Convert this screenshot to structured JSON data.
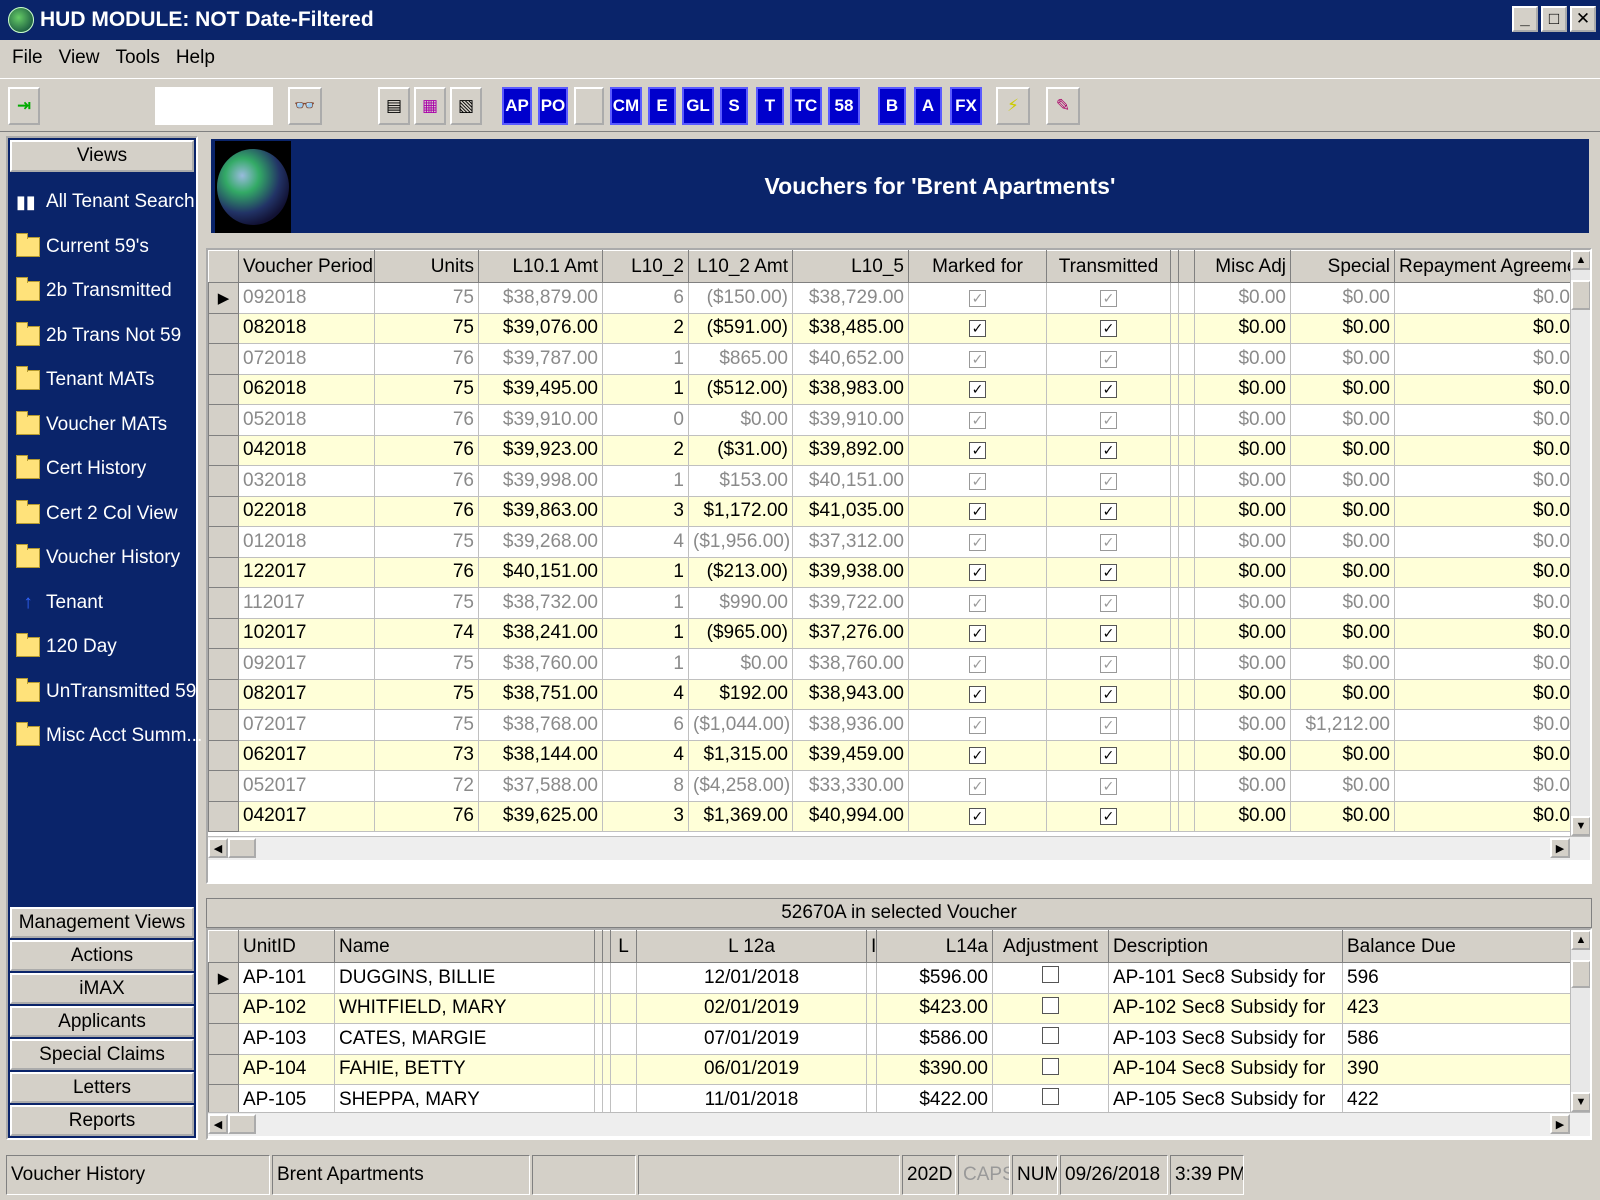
{
  "window": {
    "title": "HUD MODULE: NOT Date-Filtered",
    "minimize": "_",
    "maximize": "□",
    "close": "✕"
  },
  "menu": [
    "File",
    "View",
    "Tools",
    "Help"
  ],
  "toolbar": {
    "search_value": "",
    "letter_buttons": [
      "AP",
      "PO",
      "CM",
      "E",
      "GL",
      "S",
      "T",
      "TC",
      "58",
      "B",
      "A",
      "FX"
    ]
  },
  "sidebar": {
    "header": "Views",
    "items": [
      {
        "label": "All Tenant Search",
        "icon": "binoculars-icon"
      },
      {
        "label": "Current 59's",
        "icon": "folder-icon"
      },
      {
        "label": "2b Transmitted",
        "icon": "folder-icon"
      },
      {
        "label": "2b Trans Not 59",
        "icon": "folder-icon"
      },
      {
        "label": "Tenant MATs",
        "icon": "folder-icon"
      },
      {
        "label": "Voucher MATs",
        "icon": "folder-icon"
      },
      {
        "label": "Cert History",
        "icon": "folder-icon"
      },
      {
        "label": "Cert 2 Col View",
        "icon": "folder-icon"
      },
      {
        "label": "Voucher History",
        "icon": "folder-icon"
      },
      {
        "label": "Tenant",
        "icon": "person-icon"
      },
      {
        "label": "120 Day",
        "icon": "folder-icon"
      },
      {
        "label": "UnTransmitted 59",
        "icon": "folder-icon"
      },
      {
        "label": "Misc Acct Summ...",
        "icon": "folder-icon"
      }
    ],
    "buttons": [
      "Management Views",
      "Actions",
      "iMAX",
      "Applicants",
      "Special Claims",
      "Letters",
      "Reports"
    ]
  },
  "banner": {
    "title": "Vouchers for 'Brent Apartments'"
  },
  "vouchers": {
    "columns": [
      "Voucher Period",
      "Units",
      "L10.1 Amt",
      "L10_2",
      "L10_2 Amt",
      "L10_5",
      "Marked for",
      "Transmitted",
      "Misc Adj",
      "Special",
      "Repayment Agreement"
    ],
    "rows": [
      {
        "period": "092018",
        "units": "75",
        "amt": "$38,879.00",
        "l102": "6",
        "l102amt": "($150.00)",
        "l105": "$38,729.00",
        "misc": "$0.00",
        "special": "$0.00",
        "repay": "$0.0",
        "style": "grey"
      },
      {
        "period": "082018",
        "units": "75",
        "amt": "$39,076.00",
        "l102": "2",
        "l102amt": "($591.00)",
        "l105": "$38,485.00",
        "misc": "$0.00",
        "special": "$0.00",
        "repay": "$0.0",
        "style": "yel"
      },
      {
        "period": "072018",
        "units": "76",
        "amt": "$39,787.00",
        "l102": "1",
        "l102amt": "$865.00",
        "l105": "$40,652.00",
        "misc": "$0.00",
        "special": "$0.00",
        "repay": "$0.0",
        "style": "grey"
      },
      {
        "period": "062018",
        "units": "75",
        "amt": "$39,495.00",
        "l102": "1",
        "l102amt": "($512.00)",
        "l105": "$38,983.00",
        "misc": "$0.00",
        "special": "$0.00",
        "repay": "$0.0",
        "style": "yel"
      },
      {
        "period": "052018",
        "units": "76",
        "amt": "$39,910.00",
        "l102": "0",
        "l102amt": "$0.00",
        "l105": "$39,910.00",
        "misc": "$0.00",
        "special": "$0.00",
        "repay": "$0.0",
        "style": "grey"
      },
      {
        "period": "042018",
        "units": "76",
        "amt": "$39,923.00",
        "l102": "2",
        "l102amt": "($31.00)",
        "l105": "$39,892.00",
        "misc": "$0.00",
        "special": "$0.00",
        "repay": "$0.0",
        "style": "yel"
      },
      {
        "period": "032018",
        "units": "76",
        "amt": "$39,998.00",
        "l102": "1",
        "l102amt": "$153.00",
        "l105": "$40,151.00",
        "misc": "$0.00",
        "special": "$0.00",
        "repay": "$0.0",
        "style": "grey"
      },
      {
        "period": "022018",
        "units": "76",
        "amt": "$39,863.00",
        "l102": "3",
        "l102amt": "$1,172.00",
        "l105": "$41,035.00",
        "misc": "$0.00",
        "special": "$0.00",
        "repay": "$0.0",
        "style": "yel"
      },
      {
        "period": "012018",
        "units": "75",
        "amt": "$39,268.00",
        "l102": "4",
        "l102amt": "($1,956.00)",
        "l105": "$37,312.00",
        "misc": "$0.00",
        "special": "$0.00",
        "repay": "$0.0",
        "style": "grey"
      },
      {
        "period": "122017",
        "units": "76",
        "amt": "$40,151.00",
        "l102": "1",
        "l102amt": "($213.00)",
        "l105": "$39,938.00",
        "misc": "$0.00",
        "special": "$0.00",
        "repay": "$0.0",
        "style": "yel"
      },
      {
        "period": "112017",
        "units": "75",
        "amt": "$38,732.00",
        "l102": "1",
        "l102amt": "$990.00",
        "l105": "$39,722.00",
        "misc": "$0.00",
        "special": "$0.00",
        "repay": "$0.0",
        "style": "grey"
      },
      {
        "period": "102017",
        "units": "74",
        "amt": "$38,241.00",
        "l102": "1",
        "l102amt": "($965.00)",
        "l105": "$37,276.00",
        "misc": "$0.00",
        "special": "$0.00",
        "repay": "$0.0",
        "style": "yel"
      },
      {
        "period": "092017",
        "units": "75",
        "amt": "$38,760.00",
        "l102": "1",
        "l102amt": "$0.00",
        "l105": "$38,760.00",
        "misc": "$0.00",
        "special": "$0.00",
        "repay": "$0.0",
        "style": "grey"
      },
      {
        "period": "082017",
        "units": "75",
        "amt": "$38,751.00",
        "l102": "4",
        "l102amt": "$192.00",
        "l105": "$38,943.00",
        "misc": "$0.00",
        "special": "$0.00",
        "repay": "$0.0",
        "style": "yel"
      },
      {
        "period": "072017",
        "units": "75",
        "amt": "$38,768.00",
        "l102": "6",
        "l102amt": "($1,044.00)",
        "l105": "$38,936.00",
        "misc": "$0.00",
        "special": "$1,212.00",
        "repay": "$0.0",
        "style": "grey"
      },
      {
        "period": "062017",
        "units": "73",
        "amt": "$38,144.00",
        "l102": "4",
        "l102amt": "$1,315.00",
        "l105": "$39,459.00",
        "misc": "$0.00",
        "special": "$0.00",
        "repay": "$0.0",
        "style": "yel"
      },
      {
        "period": "052017",
        "units": "72",
        "amt": "$37,588.00",
        "l102": "8",
        "l102amt": "($4,258.00)",
        "l105": "$33,330.00",
        "misc": "$0.00",
        "special": "$0.00",
        "repay": "$0.0",
        "style": "grey"
      },
      {
        "period": "042017",
        "units": "76",
        "amt": "$39,625.00",
        "l102": "3",
        "l102amt": "$1,369.00",
        "l105": "$40,994.00",
        "misc": "$0.00",
        "special": "$0.00",
        "repay": "$0.0",
        "style": "yel"
      }
    ]
  },
  "detail": {
    "title": "52670A in selected Voucher",
    "columns": [
      "UnitID",
      "Name",
      "L",
      "L 12a",
      "I",
      "L14a",
      "Adjustment",
      "Description",
      "Balance Due"
    ],
    "rows": [
      {
        "unit": "AP-101",
        "name": "DUGGINS, BILLIE",
        "date": "12/01/2018",
        "amt": "$596.00",
        "desc": "AP-101 Sec8 Subsidy for",
        "bal": "596",
        "style": "wht"
      },
      {
        "unit": "AP-102",
        "name": "WHITFIELD, MARY",
        "date": "02/01/2019",
        "amt": "$423.00",
        "desc": "AP-102 Sec8 Subsidy for",
        "bal": "423",
        "style": "yel"
      },
      {
        "unit": "AP-103",
        "name": "CATES, MARGIE",
        "date": "07/01/2019",
        "amt": "$586.00",
        "desc": "AP-103 Sec8 Subsidy for",
        "bal": "586",
        "style": "wht"
      },
      {
        "unit": "AP-104",
        "name": "FAHIE, BETTY",
        "date": "06/01/2019",
        "amt": "$390.00",
        "desc": "AP-104 Sec8 Subsidy for",
        "bal": "390",
        "style": "yel"
      },
      {
        "unit": "AP-105",
        "name": "SHEPPA, MARY",
        "date": "11/01/2018",
        "amt": "$422.00",
        "desc": "AP-105 Sec8 Subsidy for",
        "bal": "422",
        "style": "wht"
      }
    ]
  },
  "status": {
    "view": "Voucher History",
    "property": "Brent Apartments",
    "code": "202D",
    "caps": "CAPS",
    "num": "NUM",
    "date": "09/26/2018",
    "time": "3:39 PM"
  }
}
